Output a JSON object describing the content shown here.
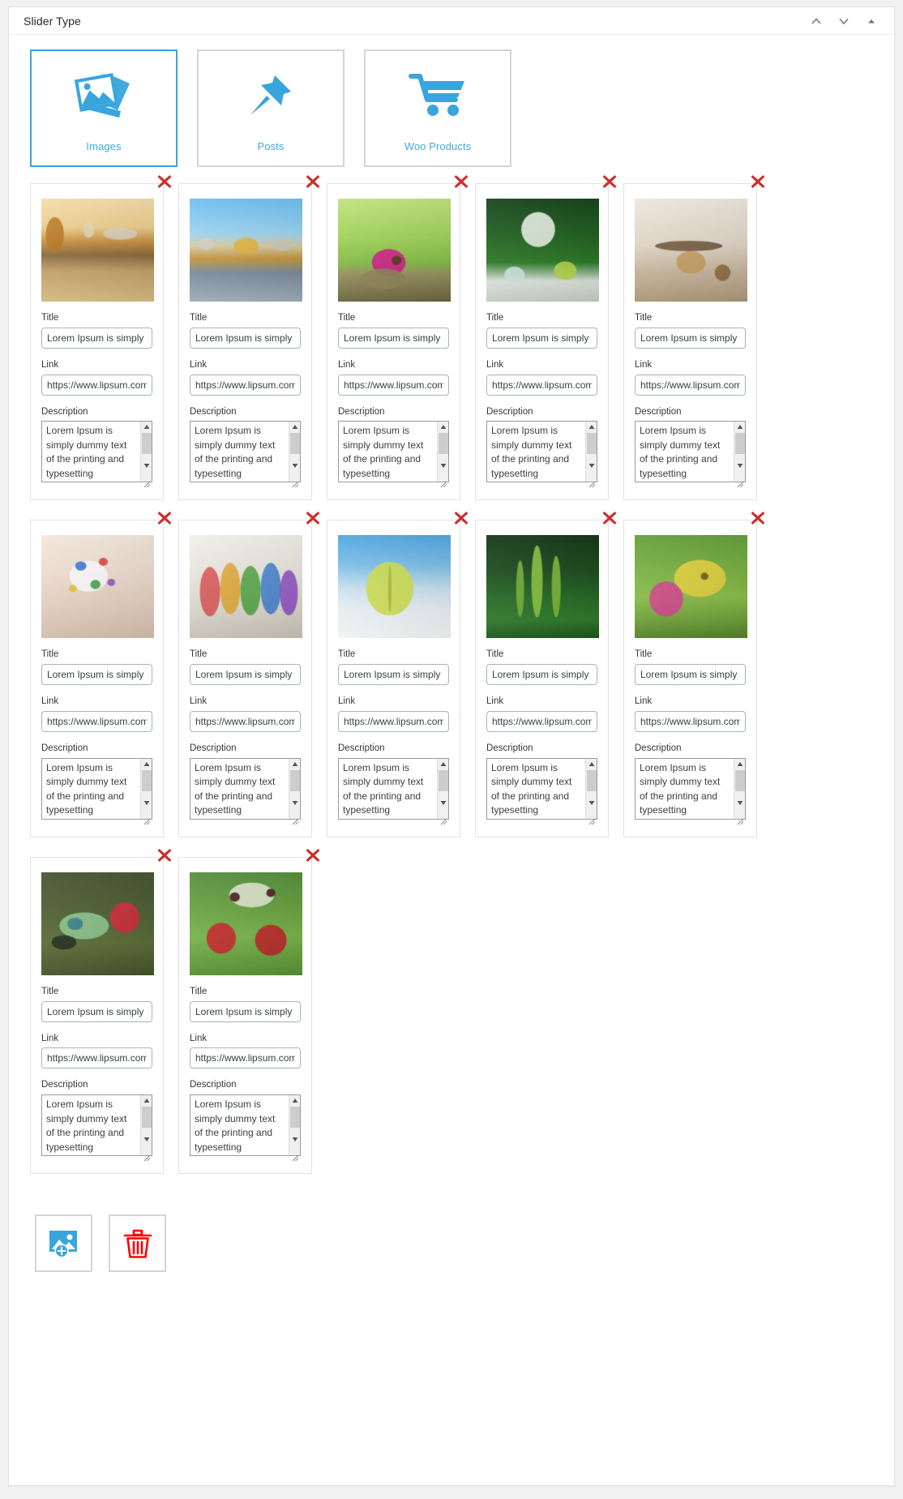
{
  "panel": {
    "title": "Slider Type",
    "header_icons": [
      {
        "name": "chevron-up-icon",
        "label": "Move up"
      },
      {
        "name": "chevron-down-icon",
        "label": "Move down"
      },
      {
        "name": "collapse-triangle-icon",
        "label": "Toggle panel"
      }
    ]
  },
  "colors": {
    "accent": "#38a5dd",
    "accent_text": "#44a7dd",
    "border": "#d5d5d5",
    "card_border": "#e2e2e2",
    "delete_red": "#c9302c",
    "trash_red": "#ff0000",
    "panel_bg": "#ffffff",
    "page_bg": "#f1f1f1"
  },
  "slider_types": [
    {
      "label": "Images",
      "icon": "images-stack-icon",
      "selected": true
    },
    {
      "label": "Posts",
      "icon": "pushpin-icon",
      "selected": false
    },
    {
      "label": "Woo Products",
      "icon": "shopping-cart-icon",
      "selected": false
    }
  ],
  "field_labels": {
    "title": "Title",
    "link": "Link",
    "description": "Description"
  },
  "slide_defaults": {
    "title_value": "Lorem Ipsum is simply",
    "link_value": "https://www.lipsum.com",
    "description_value": "Lorem Ipsum is simply dummy text of the printing and typesetting",
    "delete_icon": "delete-x-icon"
  },
  "slides": [
    {
      "index": 1,
      "image": "golden-temple-sunset",
      "title": "Lorem Ipsum is simply",
      "link": "https://www.lipsum.com",
      "description": "Lorem Ipsum is simply dummy text of the printing and typesetting"
    },
    {
      "index": 2,
      "image": "golden-temple-daytime",
      "title": "Lorem Ipsum is simply",
      "link": "https://www.lipsum.com",
      "description": "Lorem Ipsum is simply dummy text of the printing and typesetting"
    },
    {
      "index": 3,
      "image": "pink-daisy-on-rock",
      "title": "Lorem Ipsum is simply",
      "link": "https://www.lipsum.com",
      "description": "Lorem Ipsum is simply dummy text of the printing and typesetting"
    },
    {
      "index": 4,
      "image": "lime-drink-splash",
      "title": "Lorem Ipsum is simply",
      "link": "https://www.lipsum.com",
      "description": "Lorem Ipsum is simply dummy text of the printing and typesetting"
    },
    {
      "index": 5,
      "image": "wooden-toy-airplane",
      "title": "Lorem Ipsum is simply",
      "link": "https://www.lipsum.com",
      "description": "Lorem Ipsum is simply dummy text of the printing and typesetting"
    },
    {
      "index": 6,
      "image": "candy-sprinkles-glass",
      "title": "Lorem Ipsum is simply",
      "link": "https://www.lipsum.com",
      "description": "Lorem Ipsum is simply dummy text of the printing and typesetting"
    },
    {
      "index": 7,
      "image": "colored-cocktail-glasses",
      "title": "Lorem Ipsum is simply",
      "link": "https://www.lipsum.com",
      "description": "Lorem Ipsum is simply dummy text of the printing and typesetting"
    },
    {
      "index": 8,
      "image": "yellow-leaf-on-snow",
      "title": "Lorem Ipsum is simply",
      "link": "https://www.lipsum.com",
      "description": "Lorem Ipsum is simply dummy text of the printing and typesetting"
    },
    {
      "index": 9,
      "image": "green-plant-stems",
      "title": "Lorem Ipsum is simply",
      "link": "https://www.lipsum.com",
      "description": "Lorem Ipsum is simply dummy text of the printing and typesetting"
    },
    {
      "index": 10,
      "image": "yellow-butterfly-on-clover",
      "title": "Lorem Ipsum is simply",
      "link": "https://www.lipsum.com",
      "description": "Lorem Ipsum is simply dummy text of the printing and typesetting"
    },
    {
      "index": 11,
      "image": "hummingbird-red-flower",
      "title": "Lorem Ipsum is simply",
      "link": "https://www.lipsum.com",
      "description": "Lorem Ipsum is simply dummy text of the printing and typesetting"
    },
    {
      "index": 12,
      "image": "red-flowers-berries",
      "title": "Lorem Ipsum is simply",
      "link": "https://www.lipsum.com",
      "description": "Lorem Ipsum is simply dummy text of the printing and typesetting"
    }
  ],
  "bottom_actions": [
    {
      "name": "add-image-button",
      "icon": "add-image-icon",
      "label": "Add image"
    },
    {
      "name": "delete-all-button",
      "icon": "trash-icon",
      "label": "Delete all"
    }
  ]
}
